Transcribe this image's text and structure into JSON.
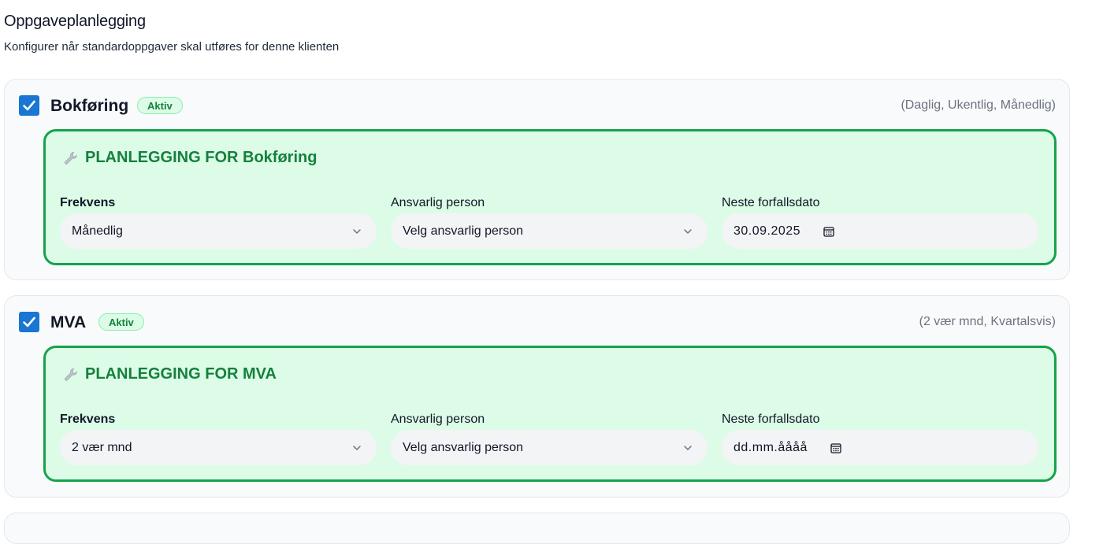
{
  "page": {
    "title": "Oppgaveplanlegging",
    "subtitle": "Konfigurer når standardoppgaver skal utføres for denne klienten"
  },
  "tasks": [
    {
      "name": "Bokføring",
      "checked": true,
      "badge": "Aktiv",
      "frequency_summary": "(Daglig, Ukentlig, Månedlig)",
      "planning_title": "PLANLEGGING FOR Bokføring",
      "frequency_label": "Frekvens",
      "frequency_value": "Månedlig",
      "responsible_label": "Ansvarlig person",
      "responsible_value": "Velg ansvarlig person",
      "due_label": "Neste forfallsdato",
      "due_value": "30.09.2025"
    },
    {
      "name": "MVA",
      "checked": true,
      "badge": "Aktiv",
      "frequency_summary": "(2 vær mnd, Kvartalsvis)",
      "planning_title": "PLANLEGGING FOR MVA",
      "frequency_label": "Frekvens",
      "frequency_value": "2 vær mnd",
      "responsible_label": "Ansvarlig person",
      "responsible_value": "Velg ansvarlig person",
      "due_label": "Neste forfallsdato",
      "due_value": "dd.mm.åååå"
    }
  ],
  "colors": {
    "accent_green": "#16a34a",
    "checkbox_blue": "#1976d2",
    "planning_bg": "#dcfce7"
  },
  "icons": [
    "check-icon",
    "wrench-icon",
    "chevron-down-icon",
    "calendar-icon"
  ]
}
